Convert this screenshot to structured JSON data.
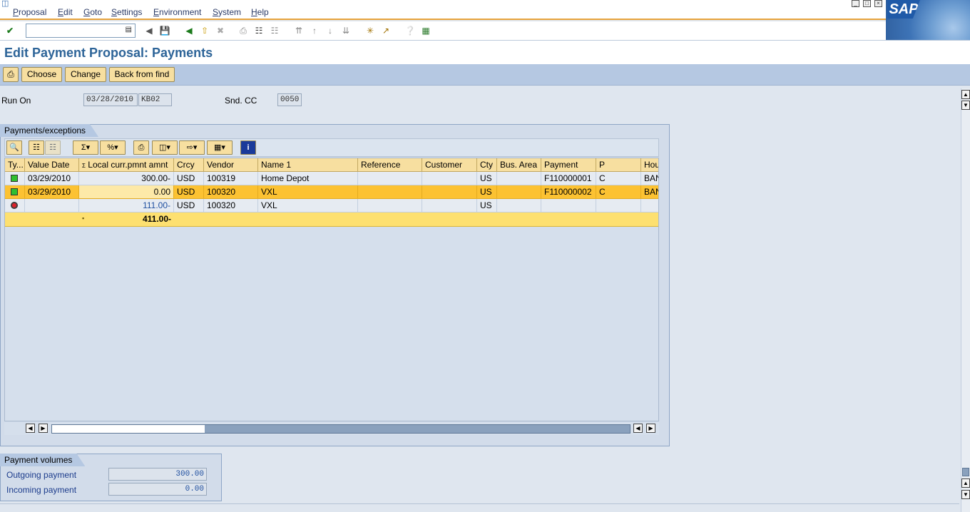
{
  "menu": [
    "Proposal",
    "Edit",
    "Goto",
    "Settings",
    "Environment",
    "System",
    "Help"
  ],
  "logo": "SAP",
  "title": "Edit Payment Proposal: Payments",
  "app_toolbar": {
    "choose": "Choose",
    "change": "Change",
    "back_from_find": "Back from find"
  },
  "header_fields": {
    "run_on_label": "Run On",
    "run_on_date": "03/28/2010",
    "run_on_id": "KB02",
    "snd_cc_label": "Snd. CC",
    "snd_cc_value": "0050"
  },
  "payments_group": {
    "title": "Payments/exceptions"
  },
  "columns": [
    "Ty...",
    "Value Date",
    "Local curr.pmnt amnt",
    "Crcy",
    "Vendor",
    "Name 1",
    "Reference",
    "Customer",
    "Cty",
    "Bus. Area",
    "Payment",
    "P",
    "Hou"
  ],
  "rows": [
    {
      "type": "green",
      "value_date": "03/29/2010",
      "amount": "300.00-",
      "crcy": "USD",
      "vendor": "100319",
      "name": "Home Depot",
      "reference": "",
      "customer": "",
      "cty": "US",
      "bus_area": "",
      "payment": "F110000001",
      "p": "C",
      "hou": "BAN"
    },
    {
      "type": "green",
      "value_date": "03/29/2010",
      "amount": "0.00",
      "crcy": "USD",
      "vendor": "100320",
      "name": "VXL",
      "reference": "",
      "customer": "",
      "cty": "US",
      "bus_area": "",
      "payment": "F110000002",
      "p": "C",
      "hou": "BAN"
    },
    {
      "type": "red",
      "value_date": "",
      "amount": "111.00-",
      "crcy": "USD",
      "vendor": "100320",
      "name": "VXL",
      "reference": "",
      "customer": "",
      "cty": "US",
      "bus_area": "",
      "payment": "",
      "p": "",
      "hou": ""
    }
  ],
  "total": {
    "marker": "▪",
    "amount": "411.00-"
  },
  "payment_volumes": {
    "title": "Payment volumes",
    "outgoing_label": "Outgoing payment",
    "outgoing_value": "300.00",
    "incoming_label": "Incoming payment",
    "incoming_value": "0.00"
  }
}
